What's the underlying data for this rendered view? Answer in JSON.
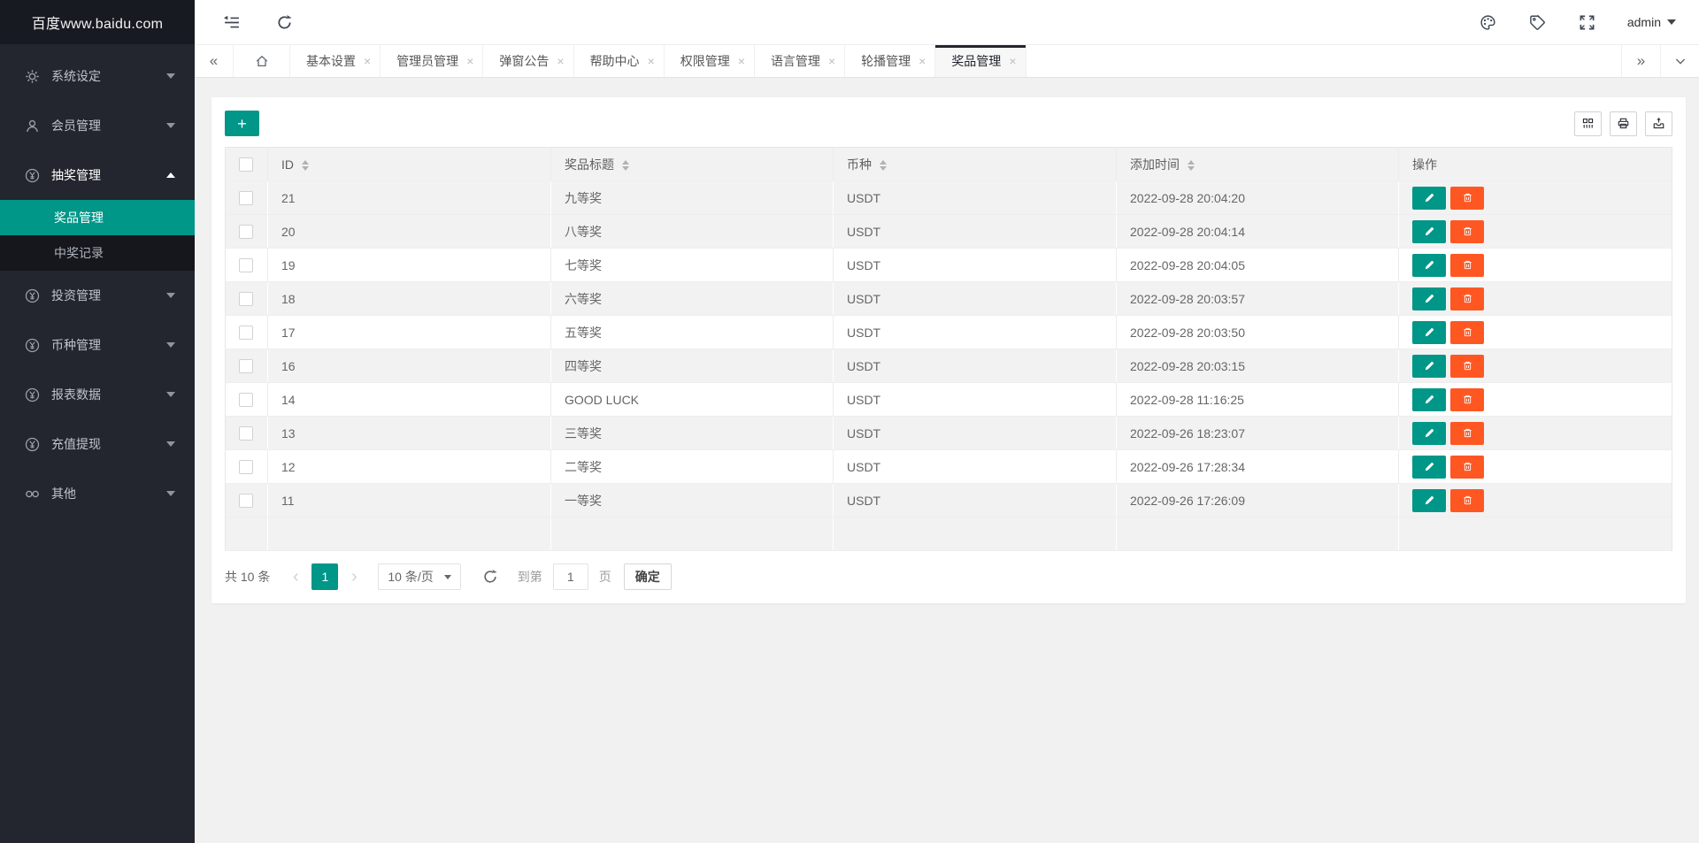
{
  "app": {
    "logo_text": "百度www.baidu.com",
    "username": "admin"
  },
  "sidebar": {
    "items": [
      {
        "id": "system",
        "label": "系统设定",
        "icon": "gear-icon",
        "state": "collapsed"
      },
      {
        "id": "members",
        "label": "会员管理",
        "icon": "user-icon",
        "state": "collapsed"
      },
      {
        "id": "lottery",
        "label": "抽奖管理",
        "icon": "yen-icon",
        "state": "expanded",
        "children": [
          {
            "id": "prizes",
            "label": "奖品管理",
            "active": true
          },
          {
            "id": "records",
            "label": "中奖记录",
            "active": false
          }
        ]
      },
      {
        "id": "invest",
        "label": "投资管理",
        "icon": "yen-icon",
        "state": "collapsed"
      },
      {
        "id": "currency",
        "label": "币种管理",
        "icon": "yen-icon",
        "state": "collapsed"
      },
      {
        "id": "reports",
        "label": "报表数据",
        "icon": "yen-icon",
        "state": "collapsed"
      },
      {
        "id": "recharge",
        "label": "充值提现",
        "icon": "yen-icon",
        "state": "collapsed"
      },
      {
        "id": "other",
        "label": "其他",
        "icon": "infinity-icon",
        "state": "collapsed"
      }
    ]
  },
  "tabbar": {
    "tabs": [
      {
        "label": "基本设置",
        "active": false
      },
      {
        "label": "管理员管理",
        "active": false
      },
      {
        "label": "弹窗公告",
        "active": false
      },
      {
        "label": "帮助中心",
        "active": false
      },
      {
        "label": "权限管理",
        "active": false
      },
      {
        "label": "语言管理",
        "active": false
      },
      {
        "label": "轮播管理",
        "active": false
      },
      {
        "label": "奖品管理",
        "active": true
      }
    ],
    "close_glyph": "×"
  },
  "toolbar": {
    "add_label": "+"
  },
  "table": {
    "columns": [
      {
        "label": "ID",
        "sortable": true
      },
      {
        "label": "奖品标题",
        "sortable": true
      },
      {
        "label": "币种",
        "sortable": true
      },
      {
        "label": "添加时间",
        "sortable": true
      },
      {
        "label": "操作",
        "sortable": false
      }
    ],
    "rows": [
      {
        "id": "21",
        "title": "九等奖",
        "currency": "USDT",
        "added_at": "2022-09-28 20:04:20",
        "shaded": true
      },
      {
        "id": "20",
        "title": "八等奖",
        "currency": "USDT",
        "added_at": "2022-09-28 20:04:14",
        "shaded": true
      },
      {
        "id": "19",
        "title": "七等奖",
        "currency": "USDT",
        "added_at": "2022-09-28 20:04:05",
        "shaded": false
      },
      {
        "id": "18",
        "title": "六等奖",
        "currency": "USDT",
        "added_at": "2022-09-28 20:03:57",
        "shaded": true
      },
      {
        "id": "17",
        "title": "五等奖",
        "currency": "USDT",
        "added_at": "2022-09-28 20:03:50",
        "shaded": false
      },
      {
        "id": "16",
        "title": "四等奖",
        "currency": "USDT",
        "added_at": "2022-09-28 20:03:15",
        "shaded": true
      },
      {
        "id": "14",
        "title": "GOOD LUCK",
        "currency": "USDT",
        "added_at": "2022-09-28 11:16:25",
        "shaded": false
      },
      {
        "id": "13",
        "title": "三等奖",
        "currency": "USDT",
        "added_at": "2022-09-26 18:23:07",
        "shaded": true
      },
      {
        "id": "12",
        "title": "二等奖",
        "currency": "USDT",
        "added_at": "2022-09-26 17:28:34",
        "shaded": false
      },
      {
        "id": "11",
        "title": "一等奖",
        "currency": "USDT",
        "added_at": "2022-09-26 17:26:09",
        "shaded": true
      }
    ]
  },
  "pagination": {
    "total_label": "共 10 条",
    "prev_glyph": "‹",
    "next_glyph": "›",
    "current_page": "1",
    "page_size_label": "10 条/页",
    "goto_prefix": "到第",
    "goto_value": "1",
    "goto_suffix": "页",
    "confirm_label": "确定"
  },
  "colors": {
    "accent": "#009688",
    "danger": "#FF5722",
    "sidebar_bg": "#23262e",
    "stripe": "#f2f2f2"
  }
}
